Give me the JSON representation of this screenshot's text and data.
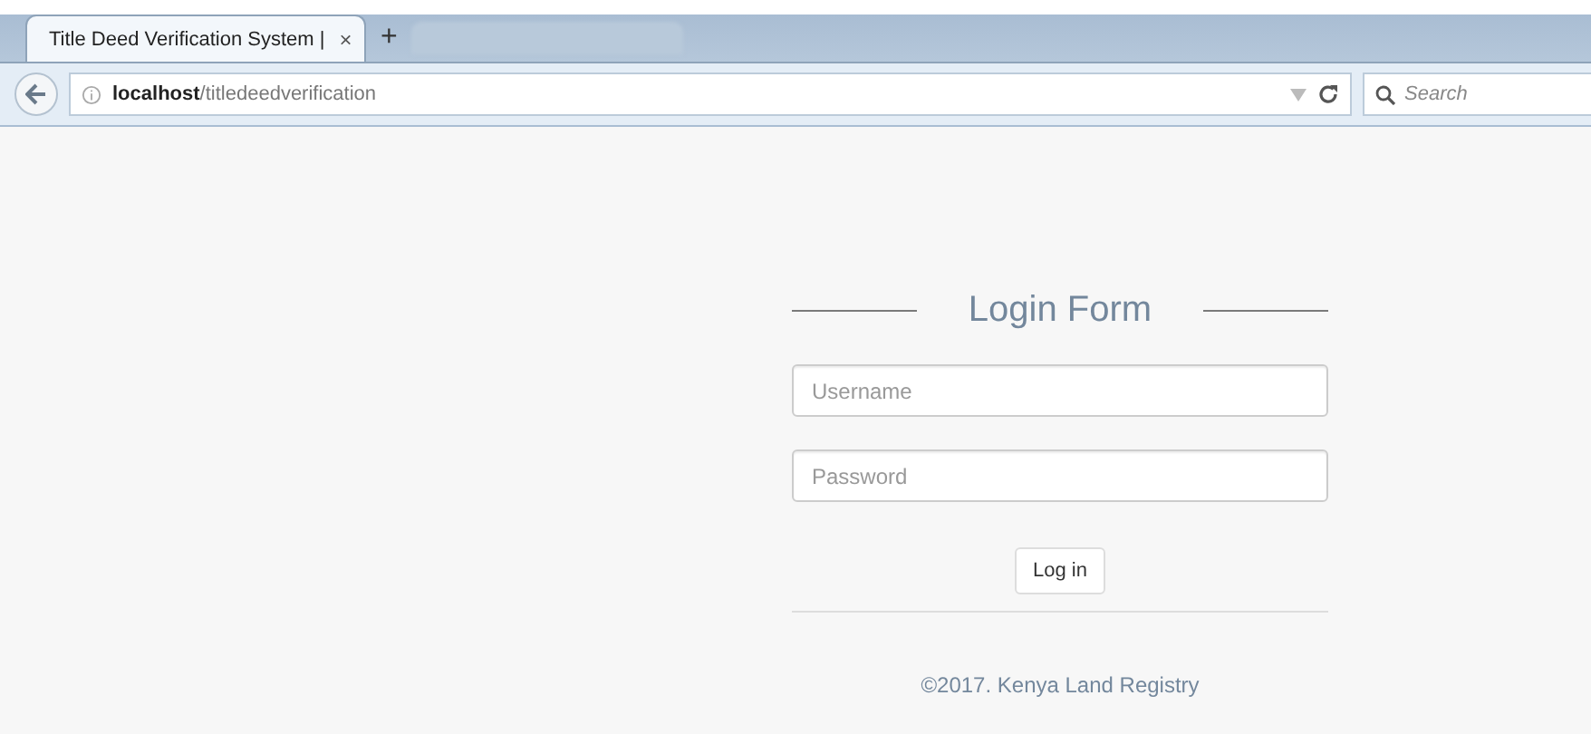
{
  "browser": {
    "tabs": [
      {
        "title": "Title Deed Verification System |",
        "close": "×",
        "selected": true
      }
    ],
    "new_tab": "+",
    "address": "**localhost**/titledeedverification",
    "search": {
      "placeholder": "Search"
    }
  },
  "login": {
    "title": "Login Form",
    "username": {
      "placeholder": "Username"
    },
    "password": {
      "placeholder": "Password"
    },
    "button": "Log in",
    "footer": "©2017. Kenya Land Registry"
  }
}
